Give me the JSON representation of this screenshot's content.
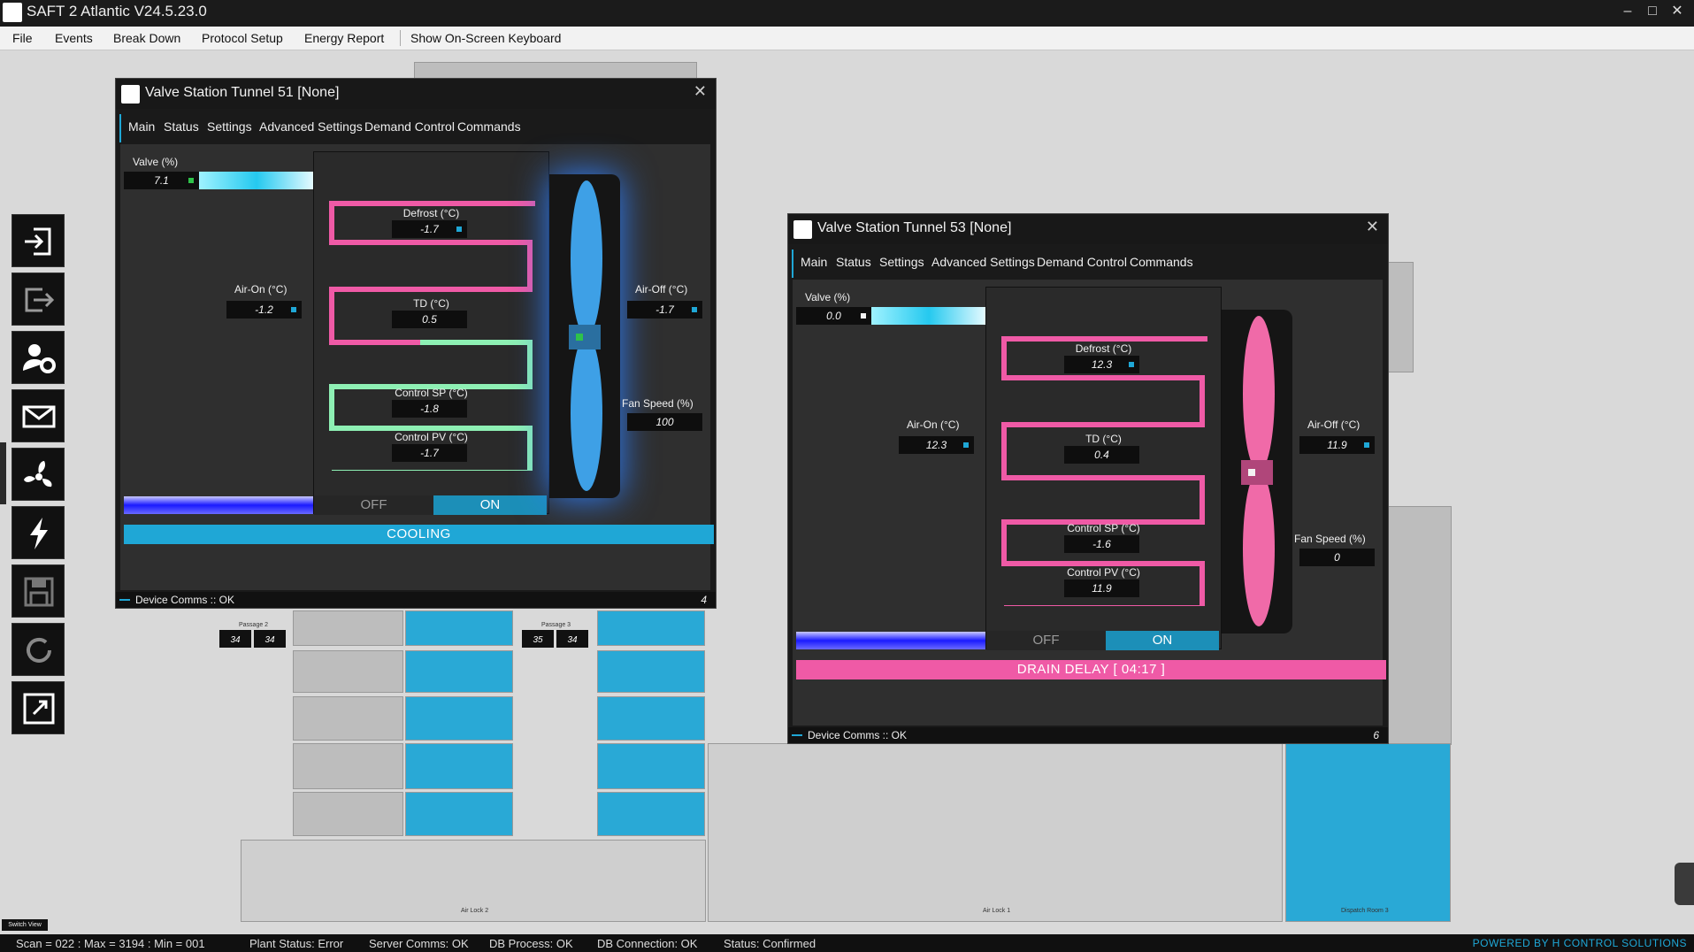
{
  "app": {
    "title": "SAFT 2 Atlantic V24.5.23.0"
  },
  "menu": {
    "items": [
      "File",
      "Events",
      "Break Down",
      "Protocol Setup",
      "Energy Report",
      "Show On-Screen Keyboard"
    ]
  },
  "sidebar": {
    "buttons": [
      "login-icon",
      "logout-icon",
      "user-settings-icon",
      "mail-icon",
      "fan-icon",
      "lightning-icon",
      "save-icon",
      "refresh-icon",
      "fullscreen-icon"
    ]
  },
  "background": {
    "passage_labels": [
      "Passage 2",
      "Passage 3"
    ],
    "passage_values": [
      "34",
      "34",
      "35",
      "34"
    ],
    "tile_labels": [
      "Air Lock 2",
      "Air Lock 1",
      "Dispatch Room 3"
    ],
    "switch_view": "Switch View"
  },
  "tunnel51": {
    "title": "Valve Station Tunnel 51 [None]",
    "tabs": [
      "Main",
      "Status",
      "Settings",
      "Advanced Settings",
      "Demand Control",
      "Commands"
    ],
    "valve_label": "Valve (%)",
    "valve_value": "7.1",
    "defrost_label": "Defrost (°C)",
    "defrost_value": "-1.7",
    "td_label": "TD (°C)",
    "td_value": "0.5",
    "control_sp_label": "Control SP (°C)",
    "control_sp_value": "-1.8",
    "control_pv_label": "Control PV (°C)",
    "control_pv_value": "-1.7",
    "air_on_label": "Air-On (°C)",
    "air_on_value": "-1.2",
    "air_off_label": "Air-Off (°C)",
    "air_off_value": "-1.7",
    "fan_speed_label": "Fan Speed (%)",
    "fan_speed_value": "100",
    "off_label": "OFF",
    "on_label": "ON",
    "state": "COOLING",
    "comms": "Device Comms :: OK",
    "comms_num": "4",
    "colors": {
      "state": "#1fa7d6",
      "fan": "#3ea0e6"
    }
  },
  "tunnel53": {
    "title": "Valve Station Tunnel 53 [None]",
    "tabs": [
      "Main",
      "Status",
      "Settings",
      "Advanced Settings",
      "Demand Control",
      "Commands"
    ],
    "valve_label": "Valve (%)",
    "valve_value": "0.0",
    "defrost_label": "Defrost (°C)",
    "defrost_value": "12.3",
    "td_label": "TD (°C)",
    "td_value": "0.4",
    "control_sp_label": "Control SP (°C)",
    "control_sp_value": "-1.6",
    "control_pv_label": "Control PV (°C)",
    "control_pv_value": "11.9",
    "air_on_label": "Air-On (°C)",
    "air_on_value": "12.3",
    "air_off_label": "Air-Off (°C)",
    "air_off_value": "11.9",
    "fan_speed_label": "Fan Speed (%)",
    "fan_speed_value": "0",
    "off_label": "OFF",
    "on_label": "ON",
    "state": "DRAIN DELAY [ 04:17 ]",
    "comms": "Device Comms :: OK",
    "comms_num": "6",
    "colors": {
      "state": "#ef5aa6",
      "fan": "#f06aa8"
    }
  },
  "statusbar": {
    "scan": "Scan = 022 : Max = 3194 : Min = 001",
    "plant_status": "Plant Status: Error",
    "server_comms": "Server Comms: OK",
    "db_process": "DB Process: OK",
    "db_connection": "DB Connection: OK",
    "status": "Status: Confirmed",
    "powered_by": "POWERED BY H CONTROL SOLUTIONS"
  }
}
